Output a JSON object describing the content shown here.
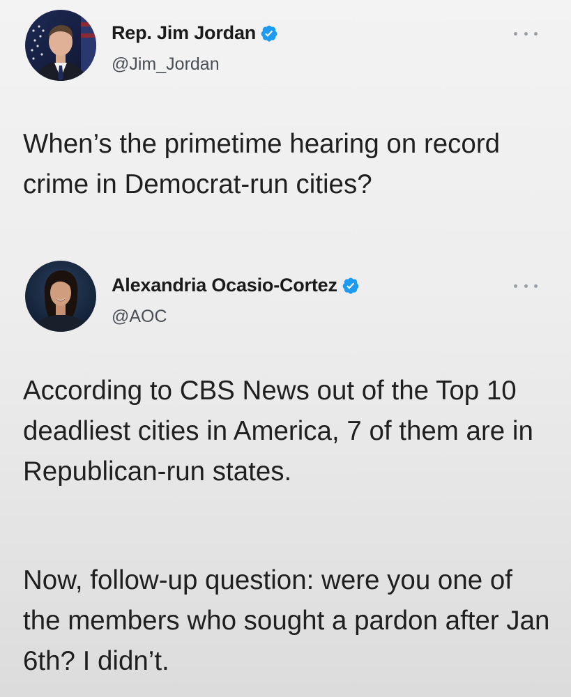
{
  "tweets": [
    {
      "display_name": "Rep. Jim Jordan",
      "handle": "@Jim_Jordan",
      "verified": true,
      "avatar_icon": "avatar-portrait-man-icon",
      "text": [
        "When’s the primetime hearing on record crime in Democrat-run cities?"
      ]
    },
    {
      "display_name": "Alexandria Ocasio-Cortez",
      "handle": "@AOC",
      "verified": true,
      "avatar_icon": "avatar-portrait-woman-icon",
      "text": [
        "According to CBS News out of the Top 10 deadliest cities in America, 7 of them are in Republican-run states.",
        "Now, follow-up question: were you one of the members who sought a pardon after Jan 6th? I didn’t."
      ]
    }
  ],
  "colors": {
    "verified_blue": "#1d9bf0",
    "text_primary": "#1f1f1f",
    "text_secondary": "#4a4f55",
    "more_dots": "#9aa0a6"
  }
}
